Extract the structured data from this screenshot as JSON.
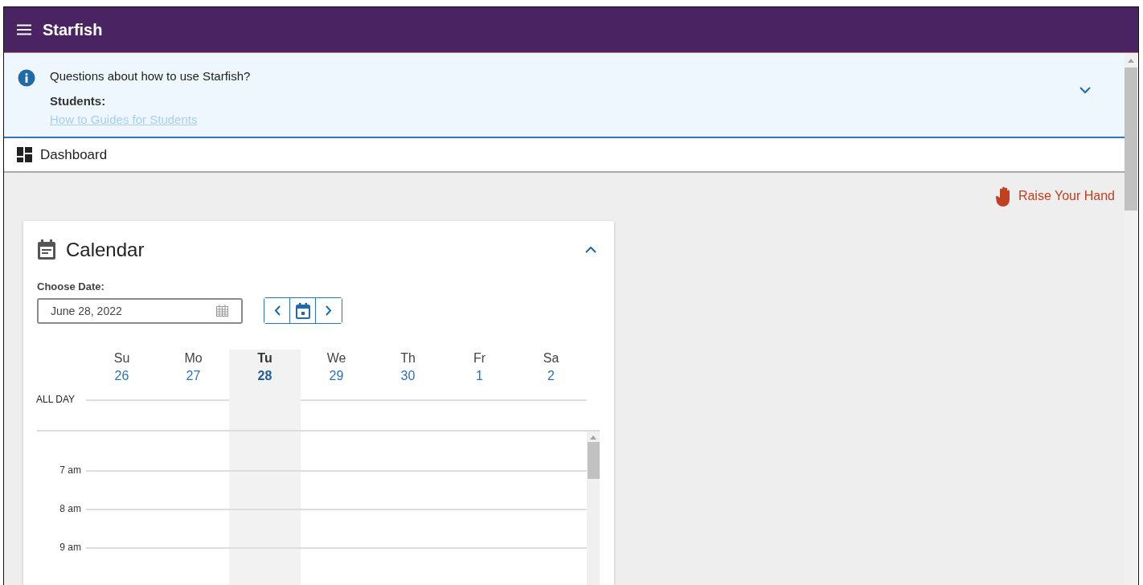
{
  "header": {
    "title": "Starfish"
  },
  "banner": {
    "question": "Questions about how to use Starfish?",
    "heading": "Students:",
    "link": "How to Guides for Students",
    "expanded": false
  },
  "page_bar": {
    "title": "Dashboard"
  },
  "raise_hand": {
    "label": "Raise Your Hand"
  },
  "calendar": {
    "title": "Calendar",
    "expanded": true,
    "date_label": "Choose Date:",
    "date_value": "June 28, 2022",
    "days": [
      {
        "name": "Su",
        "date": "26",
        "selected": false
      },
      {
        "name": "Mo",
        "date": "27",
        "selected": false
      },
      {
        "name": "Tu",
        "date": "28",
        "selected": true
      },
      {
        "name": "We",
        "date": "29",
        "selected": false
      },
      {
        "name": "Th",
        "date": "30",
        "selected": false
      },
      {
        "name": "Fr",
        "date": "1",
        "selected": false
      },
      {
        "name": "Sa",
        "date": "2",
        "selected": false
      }
    ],
    "all_day_label": "ALL DAY",
    "times": [
      "7 am",
      "8 am",
      "9 am"
    ]
  }
}
